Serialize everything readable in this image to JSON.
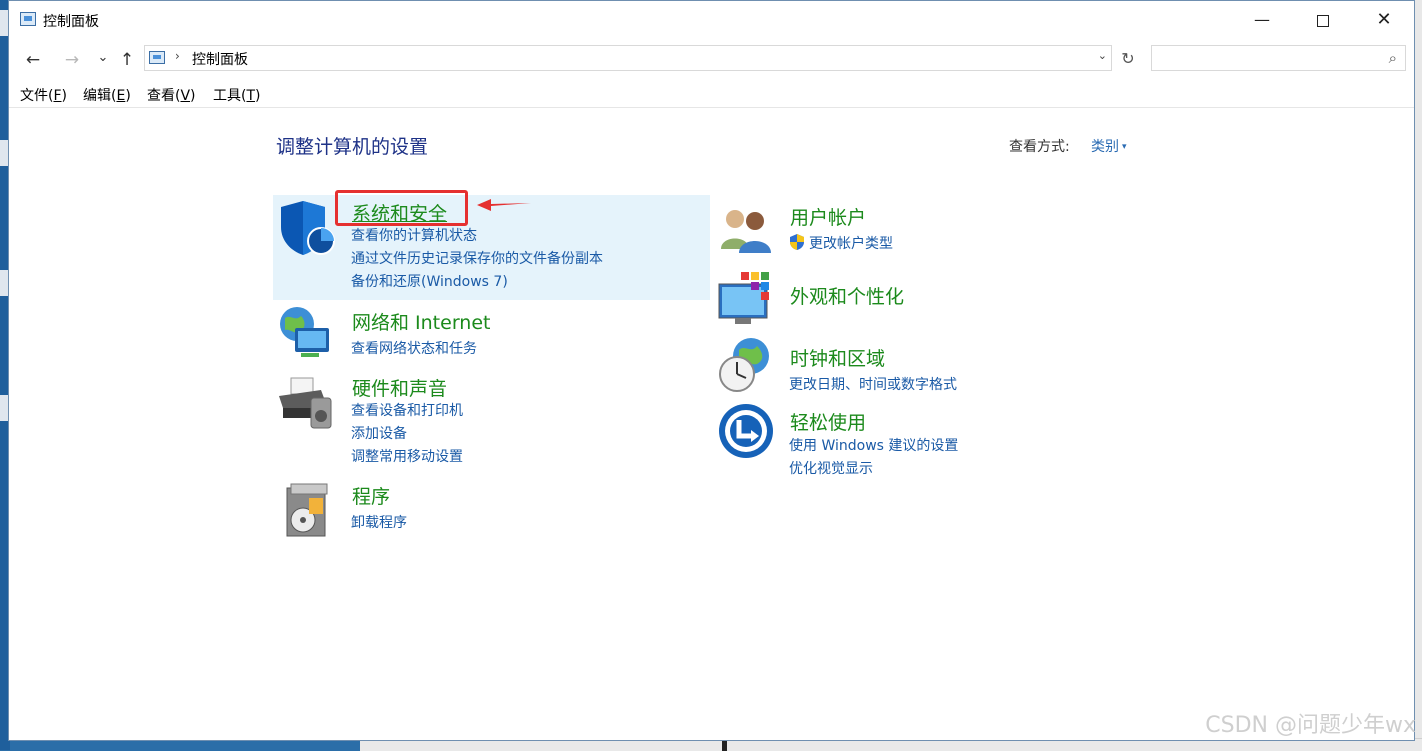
{
  "window": {
    "title": "控制面板",
    "minimize_glyph": "—",
    "close_glyph": "✕"
  },
  "nav": {
    "back_glyph": "←",
    "forward_glyph": "→",
    "recent_glyph": "⌄",
    "up_glyph": "↑",
    "address_sep": "›",
    "address": "控制面板",
    "address_dropdown_glyph": "⌄",
    "refresh_glyph": "↻",
    "search_placeholder": "",
    "search_glyph": "⌕"
  },
  "menu": [
    {
      "label": "文件",
      "key": "F"
    },
    {
      "label": "编辑",
      "key": "E"
    },
    {
      "label": "查看",
      "key": "V"
    },
    {
      "label": "工具",
      "key": "T"
    }
  ],
  "main": {
    "title": "调整计算机的设置",
    "view_by_label": "查看方式:",
    "view_by_value": "类别",
    "view_by_glyph": "▾"
  },
  "categories": {
    "system_security": {
      "title": "系统和安全",
      "links": [
        "查看你的计算机状态",
        "通过文件历史记录保存你的文件备份副本",
        "备份和还原(Windows 7)"
      ],
      "icon": "shield-icon"
    },
    "network": {
      "title": "网络和 Internet",
      "links": [
        "查看网络状态和任务"
      ],
      "icon": "network-icon"
    },
    "hardware": {
      "title": "硬件和声音",
      "links": [
        "查看设备和打印机",
        "添加设备",
        "调整常用移动设置"
      ],
      "icon": "printer-icon"
    },
    "programs": {
      "title": "程序",
      "links": [
        "卸载程序"
      ],
      "icon": "programs-icon"
    },
    "user_accounts": {
      "title": "用户帐户",
      "links": [
        "更改帐户类型"
      ],
      "icon": "users-icon"
    },
    "appearance": {
      "title": "外观和个性化",
      "links": [],
      "icon": "appearance-icon"
    },
    "clock_region": {
      "title": "时钟和区域",
      "links": [
        "更改日期、时间或数字格式"
      ],
      "icon": "clock-globe-icon"
    },
    "ease_of_access": {
      "title": "轻松使用",
      "links": [
        "使用 Windows 建议的设置",
        "优化视觉显示"
      ],
      "icon": "ease-of-access-icon"
    }
  },
  "watermark": "CSDN @问题少年wx",
  "colors": {
    "category_title": "#1c8a1c",
    "link": "#1a5aa6",
    "page_title": "#1e3287",
    "highlight_bg": "#e5f3fb",
    "annotation_red": "#e53030"
  }
}
